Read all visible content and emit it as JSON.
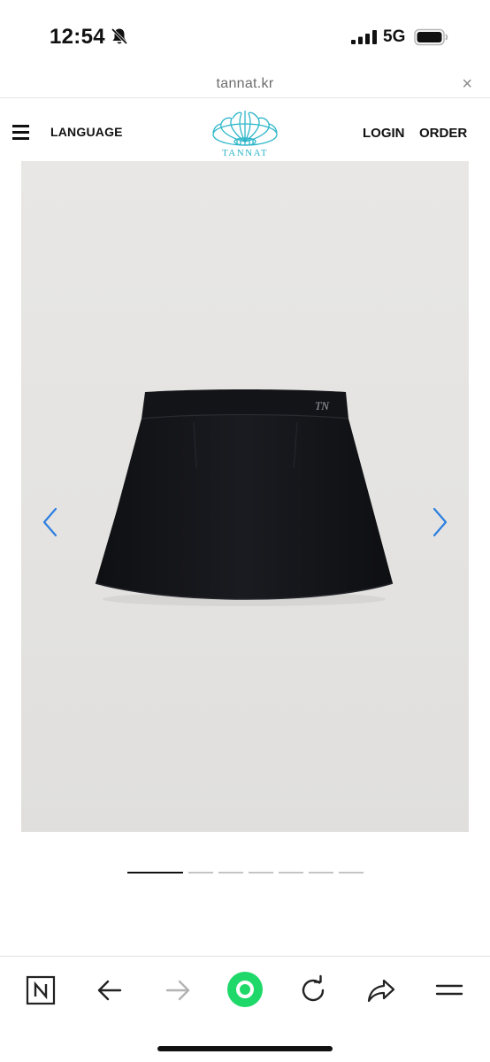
{
  "status_bar": {
    "time": "12:54",
    "network": "5G",
    "icons": [
      "bell-slash-icon",
      "signal-icon",
      "battery-icon"
    ]
  },
  "browser": {
    "url": "tannat.kr",
    "close_label": "×"
  },
  "site_header": {
    "language_label": "LANGUAGE",
    "logo_text": "TANNAT",
    "login_label": "LOGIN",
    "order_label": "ORDER",
    "accent_color": "#2cb6c9"
  },
  "product_gallery": {
    "background_color": "#e5e4e2",
    "item_color": "#15161a",
    "arrow_color": "#2b7fe0",
    "prev_icon": "chevron-left-icon",
    "next_icon": "chevron-right-icon",
    "total_pages": 7,
    "active_page": 1
  },
  "toolbar": {
    "buttons": [
      "naver-n-icon",
      "back-arrow-icon",
      "forward-arrow-icon",
      "green-home-icon",
      "reload-icon",
      "share-icon",
      "menu-lines-icon"
    ],
    "accent_color": "#1fd86a"
  }
}
